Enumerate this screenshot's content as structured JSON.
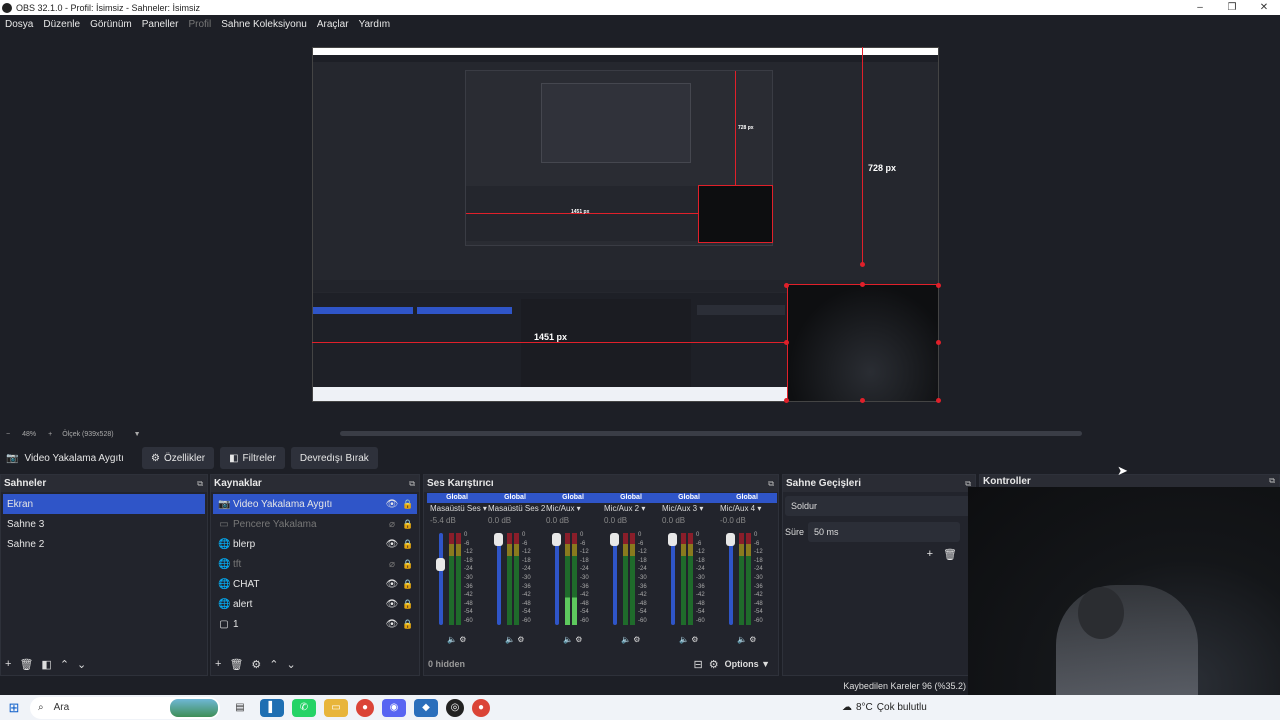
{
  "window": {
    "title": "OBS 32.1.0 - Profil: İsimsiz - Sahneler: İsimsiz"
  },
  "menu": [
    "Dosya",
    "Düzenle",
    "Görünüm",
    "Paneller",
    "Profil",
    "Sahne Koleksiyonu",
    "Araçlar",
    "Yardım"
  ],
  "preview": {
    "height_label": "728 px",
    "width_label": "1451 px",
    "nested_height_label": "728 px",
    "nested_width_label": "1451 px",
    "zoom": "48%",
    "scale_label": "Ölçek (939x528)"
  },
  "source_toolbar": {
    "source_name": "Video Yakalama Aygıtı",
    "properties": "Özellikler",
    "filters": "Filtreler",
    "deactivate": "Devredışı Bırak"
  },
  "scenes": {
    "title": "Sahneler",
    "items": [
      "Ekran",
      "Sahne 3",
      "Sahne 2"
    ]
  },
  "sources": {
    "title": "Kaynaklar",
    "items": [
      {
        "name": "Video Yakalama Aygıtı",
        "icon": "camera-icon",
        "visible": true
      },
      {
        "name": "Pencere Yakalama",
        "icon": "window-icon",
        "visible": false
      },
      {
        "name": "blerp",
        "icon": "globe-icon",
        "visible": true
      },
      {
        "name": "tft",
        "icon": "globe-icon",
        "visible": false
      },
      {
        "name": "CHAT",
        "icon": "globe-icon",
        "visible": true
      },
      {
        "name": "alert",
        "icon": "globe-icon",
        "visible": true
      },
      {
        "name": "1",
        "icon": "monitor-icon",
        "visible": true
      }
    ]
  },
  "mixer": {
    "title": "Ses Karıştırıcı",
    "global_label": "Global",
    "hidden": "0 hidden",
    "options": "Options",
    "channels": [
      {
        "name": "Masaüstü Ses",
        "db": "-5.4 dB",
        "level": 0.27,
        "active": false
      },
      {
        "name": "Masaüstü Ses 2",
        "db": "0.0 dB",
        "level": 0.0,
        "active": false
      },
      {
        "name": "Mic/Aux",
        "db": "0.0 dB",
        "level": 0.0,
        "active": true
      },
      {
        "name": "Mic/Aux 2",
        "db": "0.0 dB",
        "level": 0.0,
        "active": false
      },
      {
        "name": "Mic/Aux 3",
        "db": "0.0 dB",
        "level": 0.0,
        "active": false
      },
      {
        "name": "Mic/Aux 4",
        "db": "-0.0 dB",
        "level": 0.0,
        "active": false
      }
    ],
    "scale": [
      "0",
      "-6",
      "-12",
      "-18",
      "-24",
      "-30",
      "-36",
      "-42",
      "-48",
      "-54",
      "-60"
    ]
  },
  "transitions": {
    "title": "Sahne Geçişleri",
    "selected": "Soldur",
    "duration_label": "Süre",
    "duration": "50 ms"
  },
  "controls": {
    "title": "Kontroller"
  },
  "status": {
    "dropped_frames": "Kaybedilen Kareler 96 (%35.2)"
  },
  "taskbar": {
    "search_placeholder": "Ara",
    "temperature": "8°C",
    "weather": "Çok bulutlu"
  },
  "colors": {
    "accent": "#2f55c8",
    "guide_red": "#e0202a",
    "background": "#1d1f26"
  }
}
